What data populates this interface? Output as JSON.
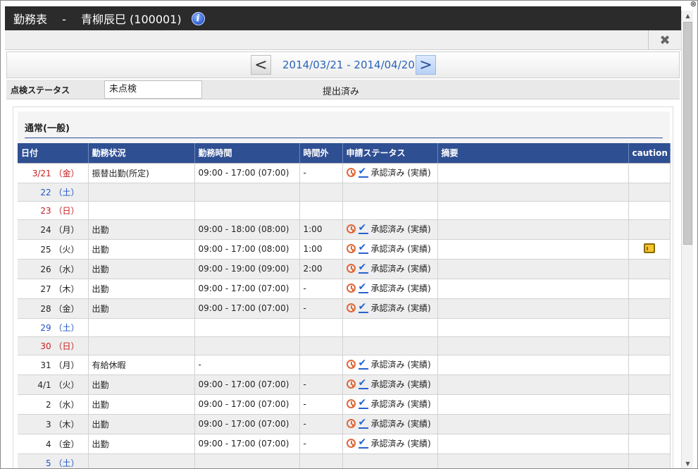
{
  "window": {
    "title": "勤務表　 -　 青柳辰巳 (100001)",
    "close_symbol": "✖",
    "corner_symbol": "⊗"
  },
  "period": {
    "prev_symbol": "<",
    "next_symbol": ">",
    "range": "2014/03/21 - 2014/04/20"
  },
  "status": {
    "label": "点検ステータス",
    "value": "未点検",
    "submit_status": "提出済み"
  },
  "section": {
    "title": "通常(一般)"
  },
  "table": {
    "headers": [
      "日付",
      "勤務状況",
      "勤務時間",
      "時間外",
      "申請ステータス",
      "摘要",
      "caution"
    ],
    "rows": [
      {
        "date": "3/21 （金）",
        "day_type": "first",
        "work": "振替出勤(所定)",
        "hours": "09:00 - 17:00 (07:00)",
        "overtime": "-",
        "status": "承認済み (実績)",
        "note": "",
        "caution": false
      },
      {
        "date": "22 （土）",
        "day_type": "sat",
        "work": "",
        "hours": "",
        "overtime": "",
        "status": "",
        "note": "",
        "caution": false
      },
      {
        "date": "23 （日）",
        "day_type": "sun",
        "work": "",
        "hours": "",
        "overtime": "",
        "status": "",
        "note": "",
        "caution": false
      },
      {
        "date": "24 （月）",
        "day_type": "weekday",
        "work": "出勤",
        "hours": "09:00 - 18:00 (08:00)",
        "overtime": "1:00",
        "status": "承認済み (実績)",
        "note": "",
        "caution": false
      },
      {
        "date": "25 （火）",
        "day_type": "weekday",
        "work": "出勤",
        "hours": "09:00 - 17:00 (08:00)",
        "overtime": "1:00",
        "status": "承認済み (実績)",
        "note": "",
        "caution": true
      },
      {
        "date": "26 （水）",
        "day_type": "weekday",
        "work": "出勤",
        "hours": "09:00 - 19:00 (09:00)",
        "overtime": "2:00",
        "status": "承認済み (実績)",
        "note": "",
        "caution": false
      },
      {
        "date": "27 （木）",
        "day_type": "weekday",
        "work": "出勤",
        "hours": "09:00 - 17:00 (07:00)",
        "overtime": "-",
        "status": "承認済み (実績)",
        "note": "",
        "caution": false
      },
      {
        "date": "28 （金）",
        "day_type": "weekday",
        "work": "出勤",
        "hours": "09:00 - 17:00 (07:00)",
        "overtime": "-",
        "status": "承認済み (実績)",
        "note": "",
        "caution": false
      },
      {
        "date": "29 （土）",
        "day_type": "sat",
        "work": "",
        "hours": "",
        "overtime": "",
        "status": "",
        "note": "",
        "caution": false
      },
      {
        "date": "30 （日）",
        "day_type": "sun",
        "work": "",
        "hours": "",
        "overtime": "",
        "status": "",
        "note": "",
        "caution": false
      },
      {
        "date": "31 （月）",
        "day_type": "weekday",
        "work": "有給休暇",
        "hours": "-",
        "overtime": "",
        "status": "承認済み (実績)",
        "note": "",
        "caution": false
      },
      {
        "date": "4/1 （火）",
        "day_type": "weekday",
        "work": "出勤",
        "hours": "09:00 - 17:00 (07:00)",
        "overtime": "-",
        "status": "承認済み (実績)",
        "note": "",
        "caution": false
      },
      {
        "date": "2 （水）",
        "day_type": "weekday",
        "work": "出勤",
        "hours": "09:00 - 17:00 (07:00)",
        "overtime": "-",
        "status": "承認済み (実績)",
        "note": "",
        "caution": false
      },
      {
        "date": "3 （木）",
        "day_type": "weekday",
        "work": "出勤",
        "hours": "09:00 - 17:00 (07:00)",
        "overtime": "-",
        "status": "承認済み (実績)",
        "note": "",
        "caution": false
      },
      {
        "date": "4 （金）",
        "day_type": "weekday",
        "work": "出勤",
        "hours": "09:00 - 17:00 (07:00)",
        "overtime": "-",
        "status": "承認済み (実績)",
        "note": "",
        "caution": false
      },
      {
        "date": "5 （土）",
        "day_type": "sat",
        "work": "",
        "hours": "",
        "overtime": "",
        "status": "",
        "note": "",
        "caution": false
      }
    ]
  },
  "scrollbar": {
    "up_symbol": "▲",
    "down_symbol": "▼"
  }
}
